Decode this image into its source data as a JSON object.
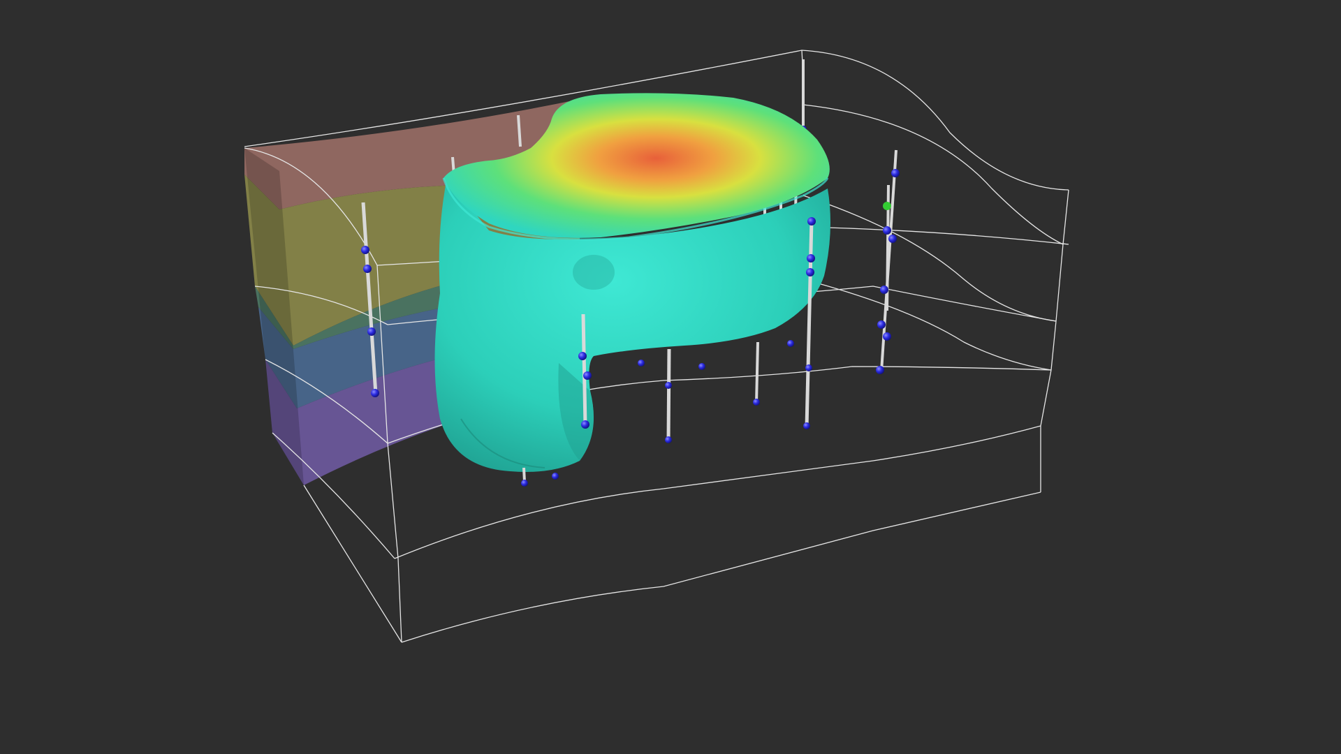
{
  "scene": {
    "background_color": "#2e2e2e",
    "frame_color": "#e6e6e6",
    "plume_base_color": "#2fd6c0",
    "borehole_marker_color": "#2020e0",
    "borehole_highlight_color": "#33cc33",
    "borehole_shaft_color": "#d9d9d9",
    "strata_colors": [
      "#9a6e66",
      "#8c8a4a",
      "#4e7a66",
      "#4a6a92",
      "#6e5aa0"
    ],
    "heat_colors": [
      "#2fd6c0",
      "#5ee07a",
      "#c8e03a",
      "#f2c03a",
      "#e8603a"
    ]
  }
}
